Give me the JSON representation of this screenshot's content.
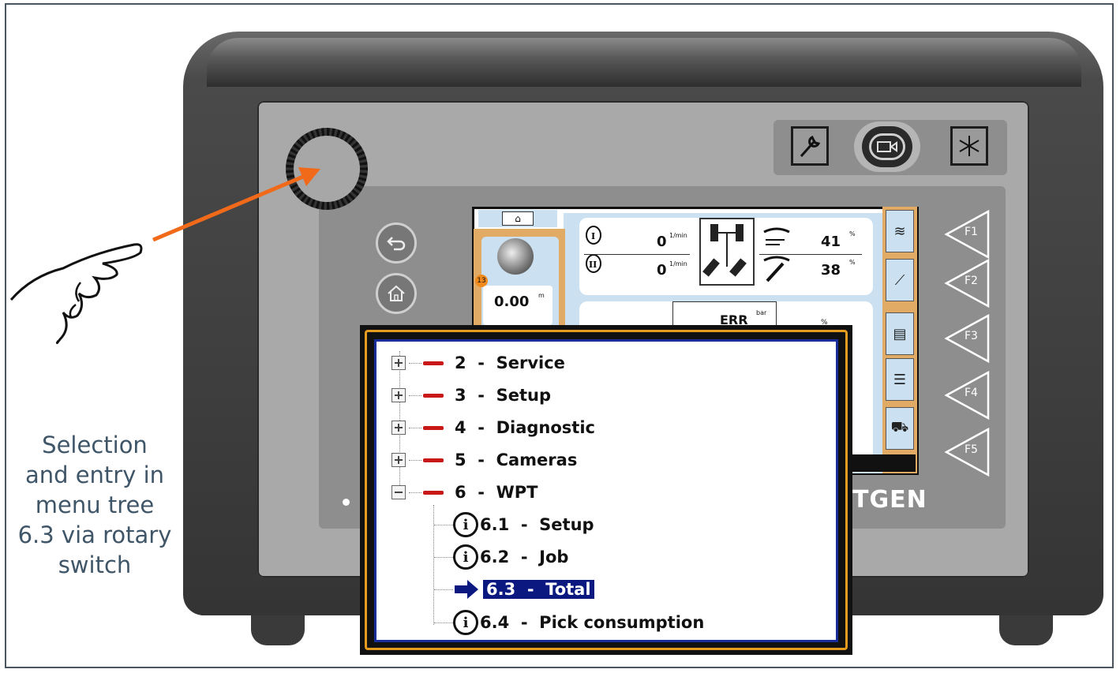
{
  "caption": {
    "text": "Selection and entry in menu tree 6.3 via rotary switch"
  },
  "device": {
    "brand": "TGEN",
    "function_keys": [
      "F1",
      "F2",
      "F3",
      "F4",
      "F5"
    ],
    "top_buttons": [
      "wrench-icon",
      "camera-icon",
      "asterisk-icon"
    ],
    "side_buttons": [
      "back-icon",
      "home-icon"
    ]
  },
  "machine_screen": {
    "left_value": "0.00",
    "left_unit": "m",
    "badge": "13",
    "engine1_value": "0",
    "engine2_value": "0",
    "engine_unit": "1/min",
    "right_top_value": "41",
    "right_bottom_value": "38",
    "right_unit": "%",
    "err_text": "ERR",
    "err_unit": "bar",
    "pct_label": "%"
  },
  "menu": {
    "items": [
      {
        "number": "2",
        "label": "Service",
        "expanded": false
      },
      {
        "number": "3",
        "label": "Setup",
        "expanded": false
      },
      {
        "number": "4",
        "label": "Diagnostic",
        "expanded": false
      },
      {
        "number": "5",
        "label": "Cameras",
        "expanded": false
      },
      {
        "number": "6",
        "label": "WPT",
        "expanded": true
      }
    ],
    "sub_items": [
      {
        "number": "6.1",
        "label": "Setup",
        "selected": false
      },
      {
        "number": "6.2",
        "label": "Job",
        "selected": false
      },
      {
        "number": "6.3",
        "label": "Total",
        "selected": true
      },
      {
        "number": "6.4",
        "label": "Pick consumption",
        "selected": false
      }
    ],
    "separator": "-"
  },
  "colors": {
    "selection": "#0a1880",
    "menu_border": "#1a2e9b",
    "gold_border": "#e59b1e",
    "red_marker": "#c81818",
    "pointer_arrow": "#f06a1a",
    "caption": "#3f5568"
  }
}
